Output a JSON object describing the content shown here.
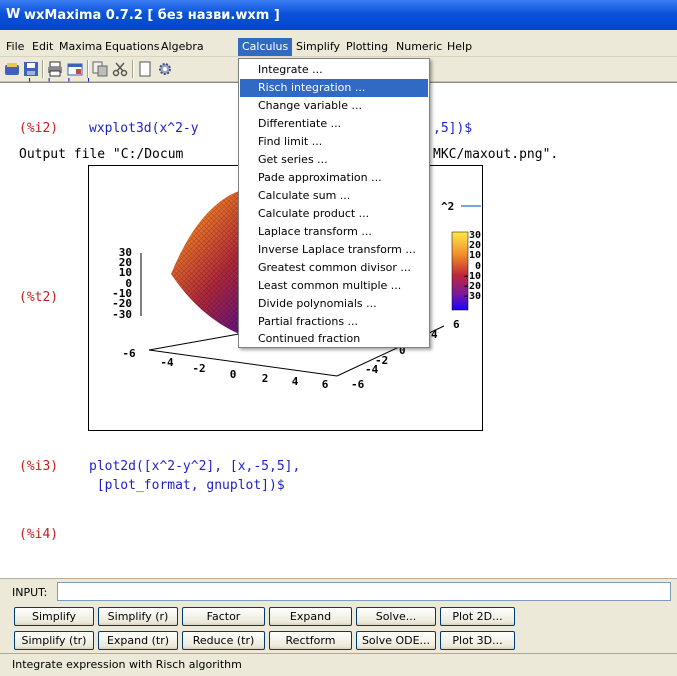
{
  "window": {
    "title": "wxMaxima 0.7.2  [ без назви.wxm ]"
  },
  "menubar": {
    "items": [
      {
        "label": "File"
      },
      {
        "label": "Edit"
      },
      {
        "label": "Maxima"
      },
      {
        "label": "Equations"
      },
      {
        "label": "Algebra"
      },
      {
        "label": "Calculus"
      },
      {
        "label": "Simplify"
      },
      {
        "label": "Plotting"
      },
      {
        "label": "Numeric"
      },
      {
        "label": "Help"
      }
    ]
  },
  "calculus_menu": {
    "items": [
      {
        "label": "Integrate ..."
      },
      {
        "label": "Risch integration ..."
      },
      {
        "label": "Change variable ..."
      },
      {
        "label": "Differentiate ..."
      },
      {
        "label": "Find limit ..."
      },
      {
        "label": "Get series ..."
      },
      {
        "label": "Pade approximation ..."
      },
      {
        "label": "Calculate sum ..."
      },
      {
        "label": "Calculate product ..."
      },
      {
        "label": "Laplace transform ..."
      },
      {
        "label": "Inverse Laplace transform ..."
      },
      {
        "label": "Greatest common divisor ..."
      },
      {
        "label": "Least common multiple ..."
      },
      {
        "label": "Divide polynomials ..."
      },
      {
        "label": "Partial fractions ..."
      },
      {
        "label": "Continued fraction"
      }
    ]
  },
  "document": {
    "cell_i2": {
      "label": "(%i2)",
      "text_left": "wxplot3d(x^2-y",
      "text_right": ",5])$"
    },
    "output_line": {
      "left": "Output file \"C:/Docum",
      "right": "MKC/maxout.png\"."
    },
    "cell_t2": {
      "label": "(%t2)"
    },
    "cell_i3": {
      "label": "(%i3)",
      "line1": "plot2d([x^2-y^2], [x,-5,5],",
      "line2": " [plot_format, gnuplot])$"
    },
    "cell_i4": {
      "label": "(%i4)"
    }
  },
  "plot": {
    "legend_text": "^2",
    "z_ticks": [
      "30",
      "20",
      "10",
      "0",
      "-10",
      "-20",
      "-30"
    ],
    "colorbar_ticks": [
      "30",
      "20",
      "10",
      "0",
      "-10",
      "-20",
      "-30"
    ],
    "x_ticks": [
      "-6",
      "-4",
      "-2",
      "0",
      "2",
      "4",
      "6"
    ],
    "y_ticks": [
      "-6",
      "-4",
      "-2",
      "0",
      "2",
      "4",
      "6"
    ]
  },
  "input": {
    "label": "INPUT:",
    "value": ""
  },
  "buttons": {
    "row1": [
      "Simplify",
      "Simplify (r)",
      "Factor",
      "Expand",
      "Solve...",
      "Plot 2D..."
    ],
    "row2": [
      "Simplify (tr)",
      "Expand (tr)",
      "Reduce (tr)",
      "Rectform",
      "Solve ODE...",
      "Plot 3D..."
    ]
  },
  "status": {
    "text": "Integrate expression with Risch algorithm"
  },
  "colors": {
    "selection": "#316ac5",
    "label_red": "#c81e1e",
    "input_blue": "#1d1fc8"
  }
}
